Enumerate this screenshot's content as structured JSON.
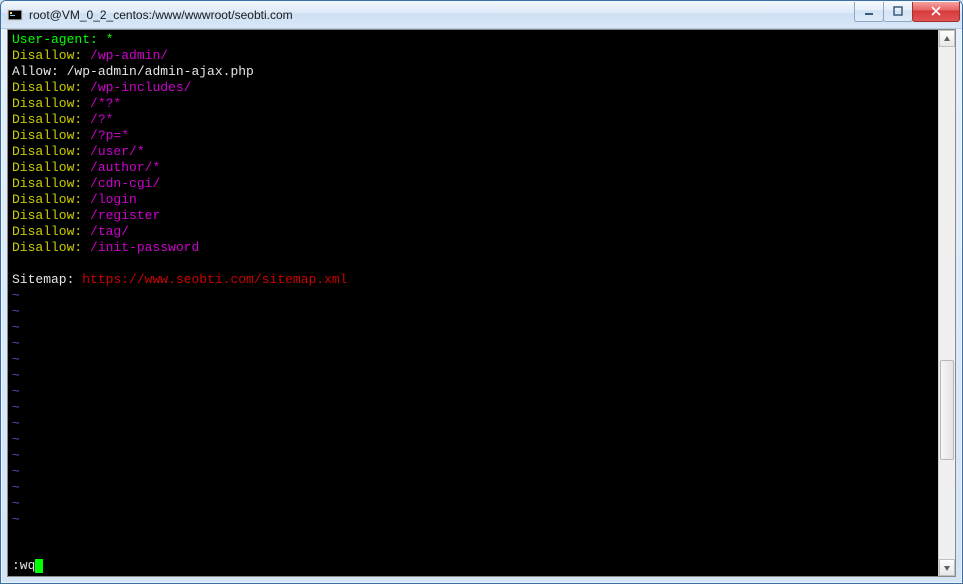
{
  "window": {
    "title": "root@VM_0_2_centos:/www/wwwroot/seobti.com"
  },
  "robots": {
    "user_agent_key": "User-agent:",
    "user_agent_val": "*",
    "allow_key": "Allow:",
    "allow_val": "/wp-admin/admin-ajax.php",
    "disallow_key": "Disallow:",
    "disallow_vals": [
      "/wp-admin/",
      "/wp-includes/",
      "/*?*",
      "/?*",
      "/?p=*",
      "/user/*",
      "/author/*",
      "/cdn-cgi/",
      "/login",
      "/register",
      "/tag/",
      "/init-password"
    ],
    "sitemap_key": "Sitemap:",
    "sitemap_val": "https://www.seobti.com/sitemap.xml"
  },
  "vim": {
    "tilde": "~",
    "command": ":wq"
  }
}
